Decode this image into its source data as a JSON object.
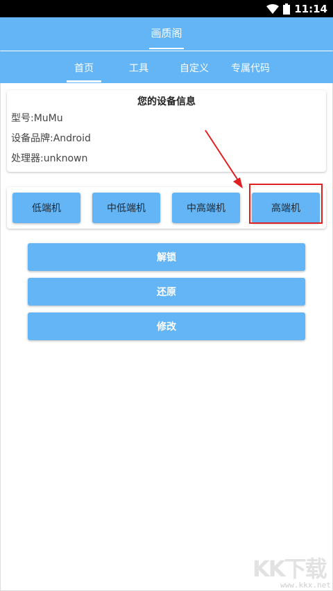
{
  "status_bar": {
    "time": "11:14"
  },
  "app_bar": {
    "title": "画质阁"
  },
  "tabs": [
    {
      "label": "首页"
    },
    {
      "label": "工具"
    },
    {
      "label": "自定义"
    },
    {
      "label": "专属代码"
    }
  ],
  "device_info": {
    "title": "您的设备信息",
    "model": "型号:MuMu",
    "brand": "设备品牌:Android",
    "processor": "处理器:unknown"
  },
  "levels": [
    {
      "label": "低端机"
    },
    {
      "label": "中低端机"
    },
    {
      "label": "中高端机"
    },
    {
      "label": "高端机"
    }
  ],
  "actions": {
    "unlock": "解锁",
    "restore": "还原",
    "modify": "修改"
  },
  "watermark": {
    "logo": "KK下载",
    "url": "www.kkx.net"
  },
  "colors": {
    "primary": "#64b5f6",
    "highlight": "#e02020"
  }
}
